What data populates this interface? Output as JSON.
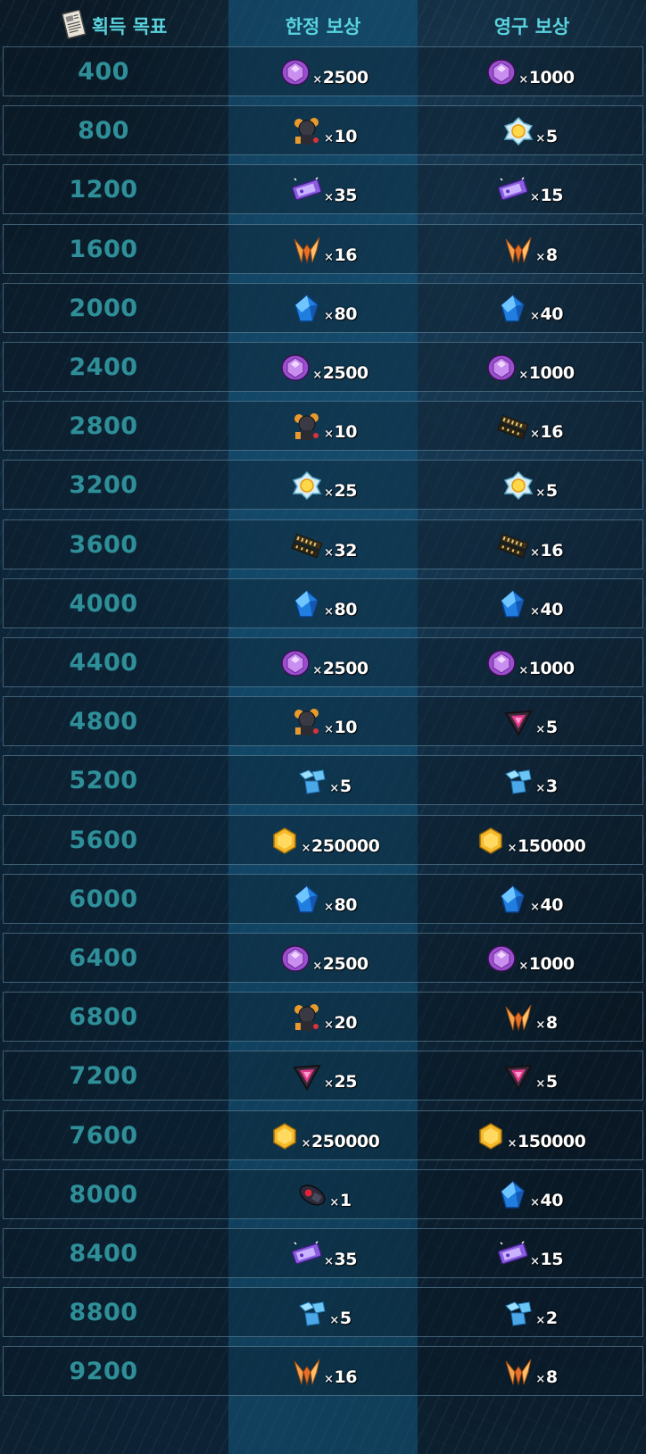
{
  "header": {
    "goal_label": "획득 목표",
    "limited_label": "한정 보상",
    "permanent_label": "영구 보상",
    "doc_icon": "document-icon"
  },
  "rows": [
    {
      "goal": "400",
      "limited": {
        "icon": "purple-orb",
        "qty": "2500"
      },
      "permanent": {
        "icon": "purple-orb",
        "qty": "1000"
      }
    },
    {
      "goal": "800",
      "limited": {
        "icon": "character-token",
        "qty": "10"
      },
      "permanent": {
        "icon": "sun-chip",
        "qty": "5"
      }
    },
    {
      "goal": "1200",
      "limited": {
        "icon": "ticket",
        "qty": "35"
      },
      "permanent": {
        "icon": "ticket",
        "qty": "15"
      }
    },
    {
      "goal": "1600",
      "limited": {
        "icon": "orange-crystal",
        "qty": "16"
      },
      "permanent": {
        "icon": "orange-crystal",
        "qty": "8"
      }
    },
    {
      "goal": "2000",
      "limited": {
        "icon": "blue-crystal",
        "qty": "80"
      },
      "permanent": {
        "icon": "blue-crystal",
        "qty": "40"
      }
    },
    {
      "goal": "2400",
      "limited": {
        "icon": "purple-orb",
        "qty": "2500"
      },
      "permanent": {
        "icon": "purple-orb",
        "qty": "1000"
      }
    },
    {
      "goal": "2800",
      "limited": {
        "icon": "character-token",
        "qty": "10"
      },
      "permanent": {
        "icon": "circuit-chip",
        "qty": "16"
      }
    },
    {
      "goal": "3200",
      "limited": {
        "icon": "sun-chip",
        "qty": "25"
      },
      "permanent": {
        "icon": "sun-chip",
        "qty": "5"
      }
    },
    {
      "goal": "3600",
      "limited": {
        "icon": "circuit-chip",
        "qty": "32"
      },
      "permanent": {
        "icon": "circuit-chip",
        "qty": "16"
      }
    },
    {
      "goal": "4000",
      "limited": {
        "icon": "blue-crystal",
        "qty": "80"
      },
      "permanent": {
        "icon": "blue-crystal",
        "qty": "40"
      }
    },
    {
      "goal": "4400",
      "limited": {
        "icon": "purple-orb",
        "qty": "2500"
      },
      "permanent": {
        "icon": "purple-orb",
        "qty": "1000"
      }
    },
    {
      "goal": "4800",
      "limited": {
        "icon": "character-token",
        "qty": "10"
      },
      "permanent": {
        "icon": "pink-triangle",
        "qty": "5"
      }
    },
    {
      "goal": "5200",
      "limited": {
        "icon": "blue-cubes",
        "qty": "5"
      },
      "permanent": {
        "icon": "blue-cubes",
        "qty": "3"
      }
    },
    {
      "goal": "5600",
      "limited": {
        "icon": "gold-coin",
        "qty": "250000"
      },
      "permanent": {
        "icon": "gold-coin",
        "qty": "150000"
      }
    },
    {
      "goal": "6000",
      "limited": {
        "icon": "blue-crystal",
        "qty": "80"
      },
      "permanent": {
        "icon": "blue-crystal",
        "qty": "40"
      }
    },
    {
      "goal": "6400",
      "limited": {
        "icon": "purple-orb",
        "qty": "2500"
      },
      "permanent": {
        "icon": "purple-orb",
        "qty": "1000"
      }
    },
    {
      "goal": "6800",
      "limited": {
        "icon": "character-token",
        "qty": "20"
      },
      "permanent": {
        "icon": "orange-crystal",
        "qty": "8"
      }
    },
    {
      "goal": "7200",
      "limited": {
        "icon": "pink-triangle",
        "qty": "25"
      },
      "permanent": {
        "icon": "pink-triangle",
        "qty": "5"
      }
    },
    {
      "goal": "7600",
      "limited": {
        "icon": "gold-coin",
        "qty": "250000"
      },
      "permanent": {
        "icon": "gold-coin",
        "qty": "150000"
      }
    },
    {
      "goal": "8000",
      "limited": {
        "icon": "dark-gadget",
        "qty": "1"
      },
      "permanent": {
        "icon": "blue-crystal",
        "qty": "40"
      }
    },
    {
      "goal": "8400",
      "limited": {
        "icon": "ticket",
        "qty": "35"
      },
      "permanent": {
        "icon": "ticket",
        "qty": "15"
      }
    },
    {
      "goal": "8800",
      "limited": {
        "icon": "blue-cubes",
        "qty": "5"
      },
      "permanent": {
        "icon": "blue-cubes",
        "qty": "2"
      }
    },
    {
      "goal": "9200",
      "limited": {
        "icon": "orange-crystal",
        "qty": "16"
      },
      "permanent": {
        "icon": "orange-crystal",
        "qty": "8"
      }
    }
  ],
  "multiplier_symbol": "×",
  "colors": {
    "header_text": "#59d3de",
    "goal_text": "#2f8f98",
    "qty_text": "#ffffff",
    "row_border": "#6e96af"
  }
}
